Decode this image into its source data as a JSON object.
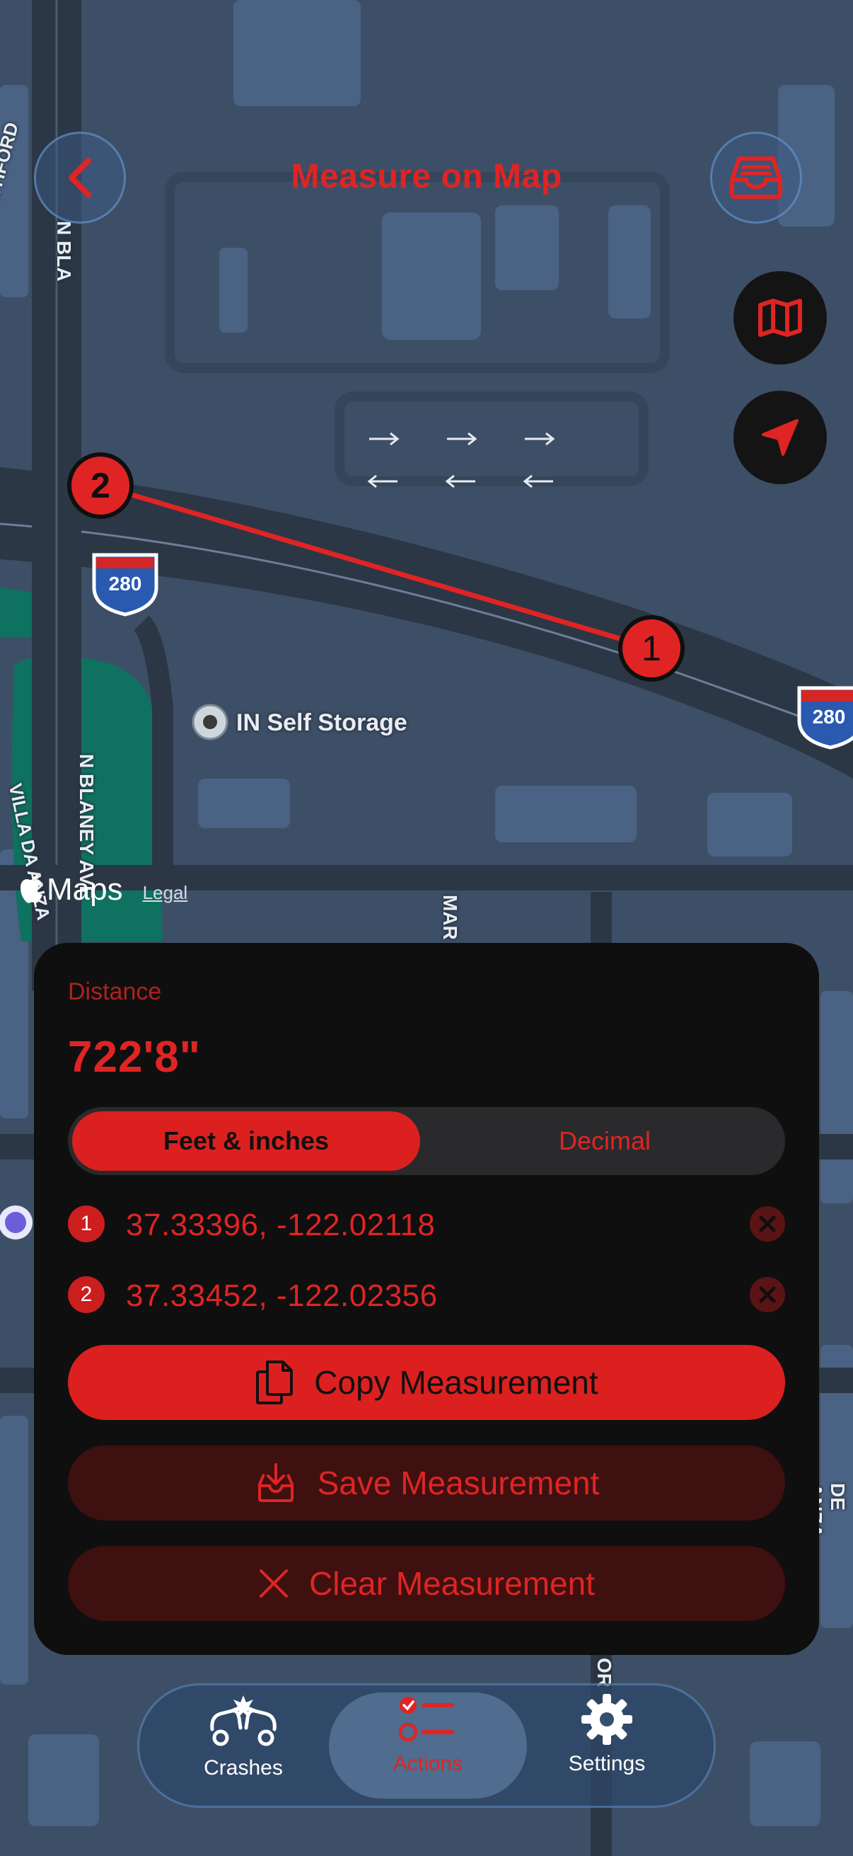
{
  "header": {
    "title": "Measure on Map",
    "back_icon": "chevron-left-icon",
    "inbox_icon": "tray-icon"
  },
  "map_controls": {
    "map_style_icon": "map-icon",
    "locate_icon": "location-arrow-icon"
  },
  "map": {
    "labels": {
      "road_northford": "NORTHFORD",
      "road_n_bla": "N BLA",
      "road_n_blaney": "N BLANEY AVE",
      "road_villa": "VILLA DA ANZA",
      "road_mar": "MAR",
      "road_right": "DE ANZA BLVD",
      "road_bottom": "OR",
      "place": "IN Self Storage",
      "shield_left": "280",
      "shield_right": "280",
      "attribution": "Maps",
      "legal": "Legal"
    },
    "markers": [
      {
        "label": "1",
        "lat": 37.33396,
        "lon": -122.02118
      },
      {
        "label": "2",
        "lat": 37.33452,
        "lon": -122.02356
      }
    ],
    "accent_color": "#e02424"
  },
  "panel": {
    "distance_label": "Distance",
    "distance_value": "722'8\"",
    "unit_options": [
      "Feet & inches",
      "Decimal"
    ],
    "selected_unit": "Feet & inches",
    "points": [
      {
        "badge": "1",
        "coords": "37.33396, -122.02118"
      },
      {
        "badge": "2",
        "coords": "37.33452, -122.02356"
      }
    ],
    "copy_label": "Copy Measurement",
    "save_label": "Save Measurement",
    "clear_label": "Clear Measurement"
  },
  "tabbar": {
    "tabs": [
      {
        "label": "Crashes",
        "icon": "crash-cars-icon",
        "active": false
      },
      {
        "label": "Actions",
        "icon": "checklist-icon",
        "active": true
      },
      {
        "label": "Settings",
        "icon": "gear-icon",
        "active": false
      }
    ]
  }
}
